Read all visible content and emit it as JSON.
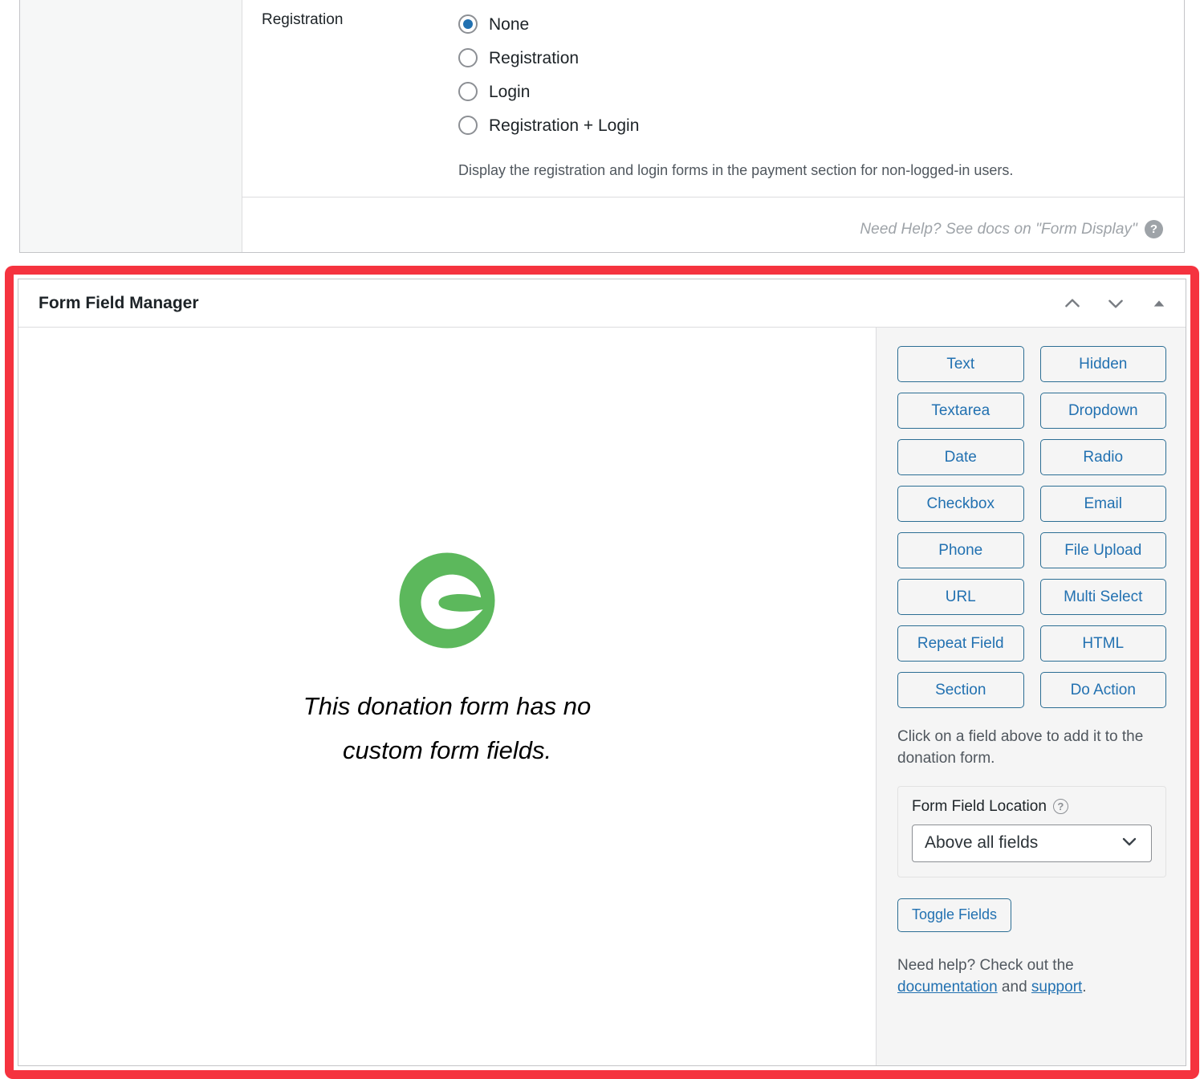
{
  "form_display": {
    "setting_label": "Registration",
    "radio_options": [
      {
        "label": "None",
        "selected": true
      },
      {
        "label": "Registration",
        "selected": false
      },
      {
        "label": "Login",
        "selected": false
      },
      {
        "label": "Registration + Login",
        "selected": false
      }
    ],
    "description": "Display the registration and login forms in the payment section for non-logged-in users.",
    "docs_text": "Need Help? See docs on \"Form Display\"",
    "docs_icon_glyph": "?",
    "docs_icon_name": "help-circle-icon"
  },
  "form_field_manager": {
    "title": "Form Field Manager",
    "header_icons": [
      {
        "name": "move-up-icon",
        "glyph": "chevron-up"
      },
      {
        "name": "move-down-icon",
        "glyph": "chevron-down"
      },
      {
        "name": "collapse-panel-icon",
        "glyph": "triangle-up"
      }
    ],
    "empty_state": {
      "logo_name": "givewp-leaf-logo",
      "logo_color": "#5cb85c",
      "message": "This donation form has no custom form fields."
    },
    "field_buttons": [
      "Text",
      "Hidden",
      "Textarea",
      "Dropdown",
      "Date",
      "Radio",
      "Checkbox",
      "Email",
      "Phone",
      "File Upload",
      "URL",
      "Multi Select",
      "Repeat Field",
      "HTML",
      "Section",
      "Do Action"
    ],
    "hint": "Click on a field above to add it to the donation form.",
    "location": {
      "label": "Form Field Location",
      "help_icon_glyph": "?",
      "selected_value": "Above all fields",
      "chevron_icon": "chevron-down"
    },
    "toggle_button_label": "Toggle Fields",
    "footer": {
      "lead": "Need help? Check out the ",
      "documentation_link": "documentation",
      "conjunction": " and ",
      "support_link": "support",
      "period": "."
    }
  },
  "colors": {
    "highlight_border": "#f5333f",
    "accent_blue": "#2271b1",
    "brand_green": "#5cb85c",
    "sidebar_gray": "#f5f5f5"
  }
}
